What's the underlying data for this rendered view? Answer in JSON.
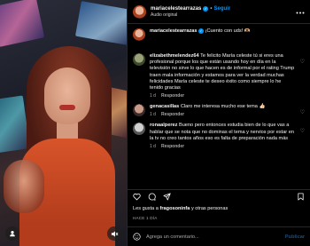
{
  "colors": {
    "accent": "#0095f6",
    "background": "#000000",
    "muted": "#a8a8a8",
    "dress": "#d8542a"
  },
  "header": {
    "username": "mariacelestearrazas",
    "separator": "•",
    "follow_label": "Seguir",
    "subtitle": "Audio original",
    "more_icon": "more-horizontal-icon"
  },
  "caption": {
    "username": "mariacelestearrazas",
    "text": "¡Cuento con uds! 🫶🏼"
  },
  "comments": [
    {
      "username": "elizabethmelendez64",
      "text": "Te felicito María celeste tú si eres una profesional porque los que están usando hoy en día en la televisión no sirve lo que hacen es de informal por el rating Trump traen mala información y estamos para ver la verdad muchas felicidades María celeste te deseo éxito como siempre lo he tenido gracias",
      "time": "1 d",
      "reply_label": "Responder"
    },
    {
      "username": "genacasillas",
      "text": "Claro me interesa mucho ese tema 👍🏻",
      "time": "1 d",
      "reply_label": "Responder"
    },
    {
      "username": "ronaalperez",
      "text": "Bueno pero entonces estudia bien de lo que vas a hablar que se nota que no dominas el tema y nervios por estar en la tv no creo tantos años eso es falta de preparación nada más",
      "time": "1 d",
      "reply_label": "Responder"
    }
  ],
  "likes": {
    "prefix": "Les gusta a",
    "user": "fragosoninfa",
    "suffix": "y otras personas"
  },
  "date": "HACE 1 DÍA",
  "composer": {
    "placeholder": "Agrega un comentario...",
    "post_label": "Publicar"
  }
}
